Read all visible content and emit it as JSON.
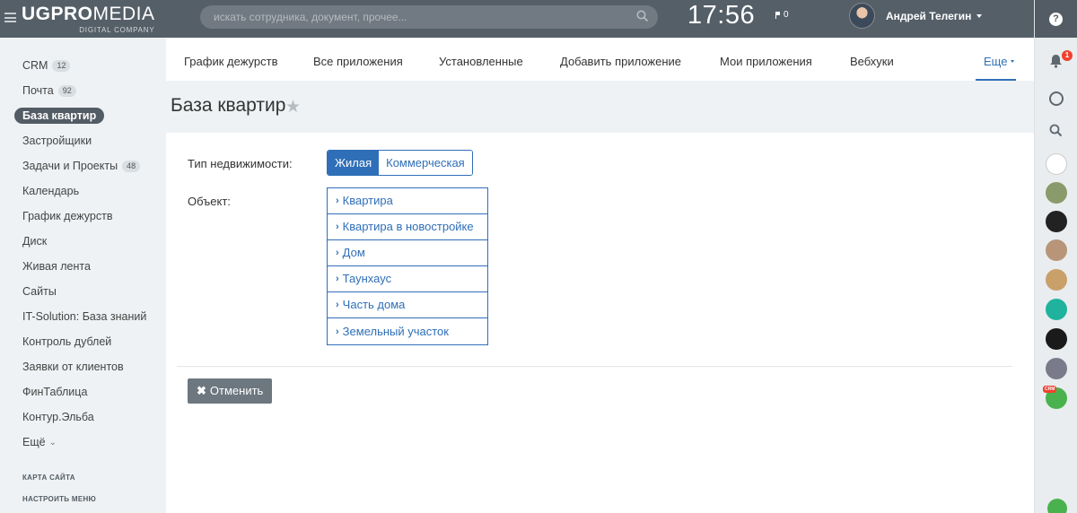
{
  "header": {
    "logo_bold": "UGPRO",
    "logo_thin": "MEDIA",
    "logo_sub": "DIGITAL COMPANY",
    "search_placeholder": "искать сотрудника, документ, прочее...",
    "clock": "17:56",
    "flag_count": "0",
    "user_name": "Андрей Телегин"
  },
  "right_panel": {
    "help": "?",
    "bell_badge": "1",
    "crm_badge": "CRM"
  },
  "sidebar": {
    "items": [
      {
        "label": "CRM",
        "count": "12"
      },
      {
        "label": "Почта",
        "count": "92"
      },
      {
        "label": "База квартир",
        "active": true
      },
      {
        "label": "Застройщики"
      },
      {
        "label": "Задачи и Проекты",
        "count": "48"
      },
      {
        "label": "Календарь"
      },
      {
        "label": "График дежурств"
      },
      {
        "label": "Диск"
      },
      {
        "label": "Живая лента"
      },
      {
        "label": "Сайты"
      },
      {
        "label": "IT-Solution: База знаний"
      },
      {
        "label": "Контроль дублей"
      },
      {
        "label": "Заявки от клиентов"
      },
      {
        "label": "ФинТаблица"
      },
      {
        "label": "Контур.Эльба"
      },
      {
        "label": "Ещё"
      }
    ],
    "sitemap": "КАРТА САЙТА",
    "configure_menu": "НАСТРОИТЬ МЕНЮ"
  },
  "tabs": [
    "График дежурств",
    "Все приложения",
    "Установленные",
    "Добавить приложение",
    "Мои приложения",
    "Вебхуки"
  ],
  "tab_more": "Еще",
  "page": {
    "title": "База квартир",
    "type_label": "Тип недвижимости:",
    "type_options": [
      "Жилая",
      "Коммерческая"
    ],
    "type_selected": "Жилая",
    "object_label": "Объект:",
    "objects": [
      "Квартира",
      "Квартира в новостройке",
      "Дом",
      "Таунхаус",
      "Часть дома",
      "Земельный участок"
    ],
    "cancel_label": "Отменить"
  },
  "colors": {
    "accent": "#2f6fb8",
    "header_bg": "#555f68",
    "badge_red": "#f0412f"
  }
}
